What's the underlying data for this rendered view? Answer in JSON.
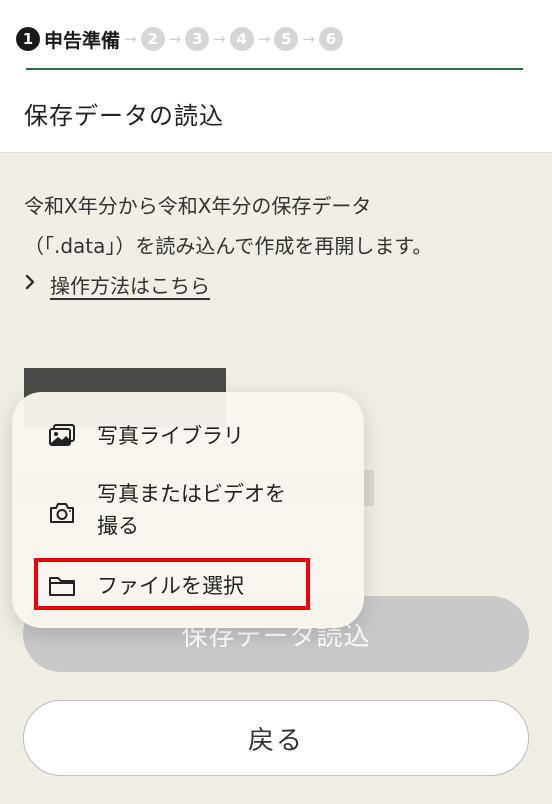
{
  "header": {
    "steps": [
      {
        "number": "1",
        "label": "申告準備",
        "active": true
      },
      {
        "number": "2",
        "active": false
      },
      {
        "number": "3",
        "active": false
      },
      {
        "number": "4",
        "active": false
      },
      {
        "number": "5",
        "active": false
      },
      {
        "number": "6",
        "active": false
      }
    ],
    "step_arrow": "→",
    "title": "保存データの読込"
  },
  "main": {
    "description_line1": "令和X年分から令和X年分の保存データ",
    "description_line2": "（「.data」）を読み込んで作成を再開します。",
    "howto_link": "操作方法はこちら",
    "load_button": "保存データ読込",
    "back_button": "戻る"
  },
  "popup_menu": {
    "items": [
      {
        "label": "写真ライブラリ",
        "icon": "photo-library-icon"
      },
      {
        "label_line1": "写真またはビデオを",
        "label_line2": "撮る",
        "icon": "camera-icon"
      },
      {
        "label": "ファイルを選択",
        "icon": "folder-icon"
      }
    ]
  },
  "colors": {
    "header_line": "#2e6b4a",
    "highlight_box": "#e8000b",
    "disabled_button": "#c9c9c9",
    "page_background": "#f1eee6"
  }
}
